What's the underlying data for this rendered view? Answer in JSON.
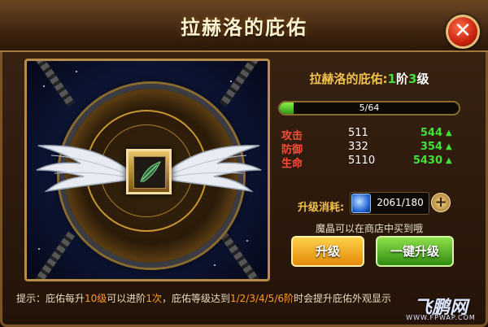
{
  "window": {
    "title": "拉赫洛的庇佑"
  },
  "info": {
    "name": "拉赫洛的庇佑",
    "colon": ":",
    "stage_num": "1",
    "stage_word": "阶",
    "level_num": "3",
    "level_word": "级"
  },
  "progress": {
    "text": "5/64",
    "current": 5,
    "max": 64
  },
  "stats": [
    {
      "name": "攻击",
      "current": "511",
      "next": "544"
    },
    {
      "name": "防御",
      "current": "332",
      "next": "354"
    },
    {
      "name": "生命",
      "current": "5110",
      "next": "5430"
    }
  ],
  "cost": {
    "label": "升级消耗:",
    "value": "2061/180",
    "item_icon": "magic-crystal-icon"
  },
  "shop_tip": "魔晶可以在商店中买到哦",
  "buttons": {
    "upgrade": "升级",
    "one_click": "一键升级"
  },
  "hint": {
    "p1": "提示：庇佑每升",
    "h1": "10级",
    "p2": "可以进阶",
    "h2": "1次",
    "p3": "，庇佑等级达到",
    "h3": "1/2/3/4/5/6阶",
    "p4": "时会提升庇佑外观显示"
  },
  "watermark": {
    "logo": "飞鹏网",
    "url": "WWW.FPWAP.COM"
  },
  "colors": {
    "title": "#fff4d0",
    "gold": "#f2c14e",
    "green": "#43e03a",
    "stat_label": "#ff4b3a",
    "highlight": "#ff9f1a"
  }
}
